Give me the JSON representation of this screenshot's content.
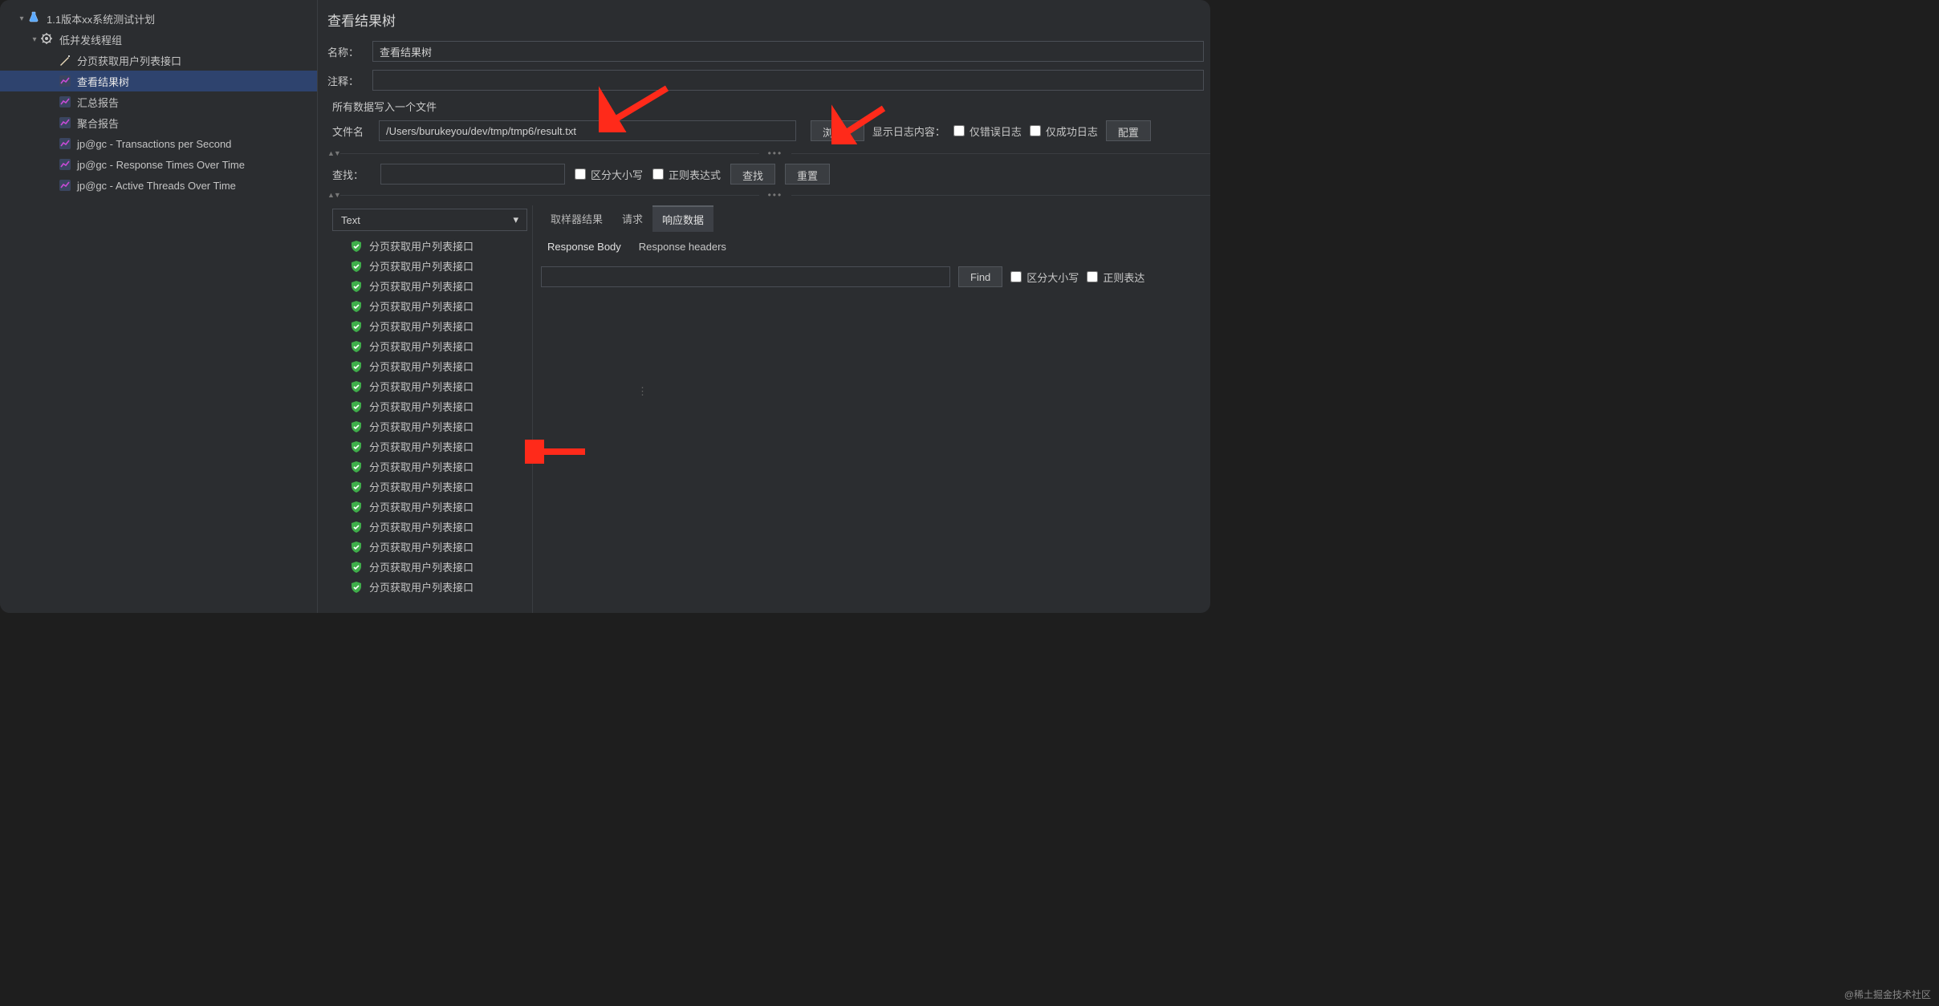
{
  "tree": {
    "root": "1.1版本xx系统测试计划",
    "group": "低并发线程组",
    "items": [
      "分页获取用户列表接口",
      "查看结果树",
      "汇总报告",
      "聚合报告",
      "jp@gc - Transactions per Second",
      "jp@gc - Response Times Over Time",
      "jp@gc - Active Threads Over Time"
    ],
    "selected_index": 1
  },
  "panel": {
    "title": "查看结果树",
    "name_label": "名称：",
    "name_value": "查看结果树",
    "comment_label": "注释：",
    "comment_value": "",
    "write_all_label": "所有数据写入一个文件",
    "filename_label": "文件名",
    "filename_value": "/Users/burukeyou/dev/tmp/tmp6/result.txt",
    "browse_btn": "浏览...",
    "show_log_label": "显示日志内容：",
    "only_error_label": "仅错误日志",
    "only_success_label": "仅成功日志",
    "configure_btn": "配置"
  },
  "search": {
    "label": "查找：",
    "value": "",
    "case_label": "区分大小写",
    "regex_label": "正则表达式",
    "find_btn": "查找",
    "reset_btn": "重置"
  },
  "results": {
    "select_value": "Text",
    "item_label": "分页获取用户列表接口",
    "count": 18
  },
  "tabs": {
    "sampler": "取样器结果",
    "request": "请求",
    "response": "响应数据",
    "response_body": "Response Body",
    "response_headers": "Response headers"
  },
  "find": {
    "value": "",
    "btn": "Find",
    "case_label": "区分大小写",
    "regex_label": "正则表达"
  },
  "watermark": "@稀土掘金技术社区"
}
